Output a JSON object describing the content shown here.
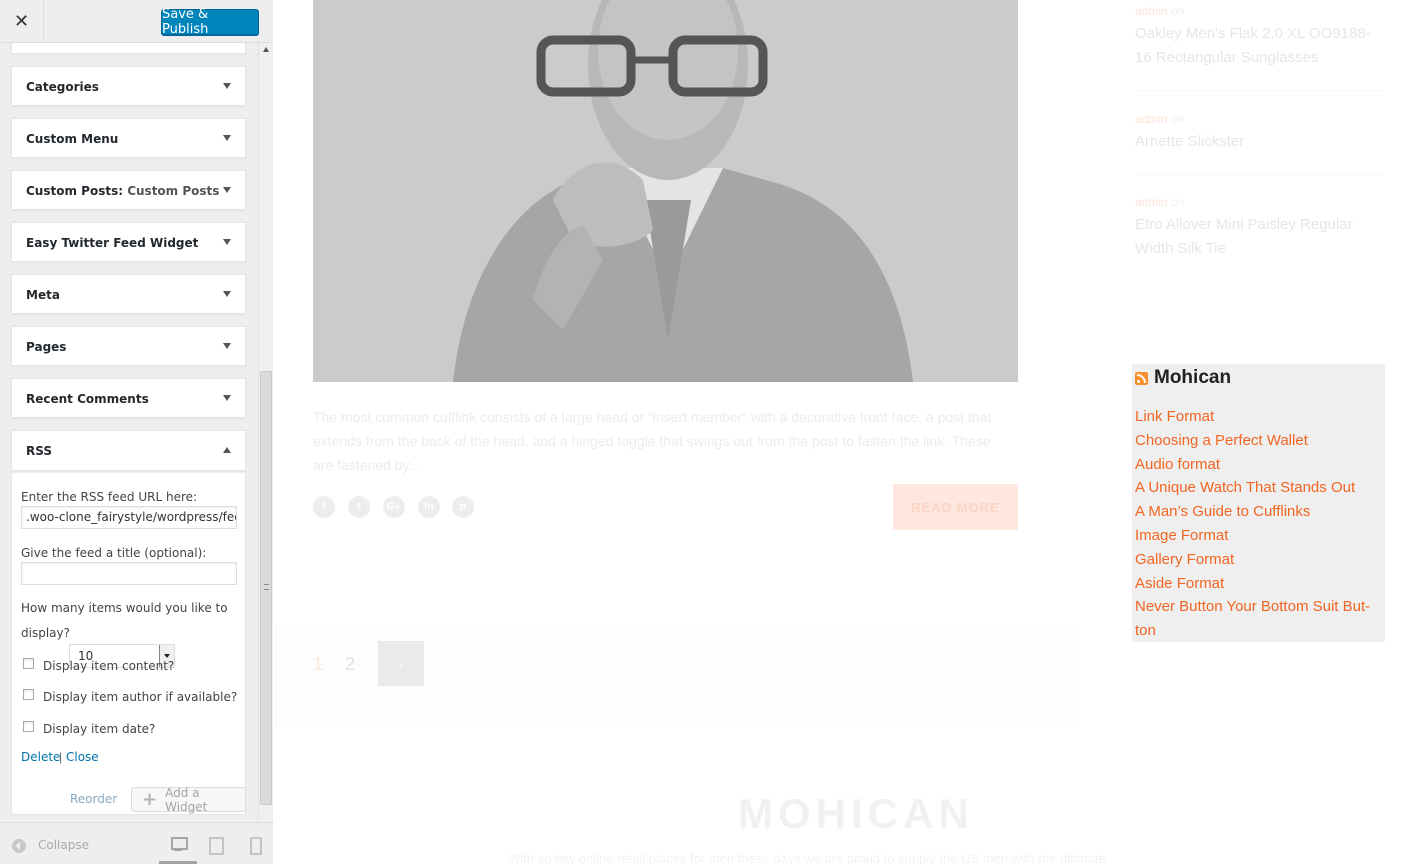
{
  "header": {
    "close_label": "✕",
    "save_label": "Save & Publish"
  },
  "widgets": [
    {
      "title": "Categories"
    },
    {
      "title": "Custom Menu"
    },
    {
      "title": "Custom Posts:",
      "subtitle": "Custom Posts"
    },
    {
      "title": "Easy Twitter Feed Widget"
    },
    {
      "title": "Meta"
    },
    {
      "title": "Pages"
    },
    {
      "title": "Recent Comments"
    },
    {
      "title": "RSS"
    }
  ],
  "rss_form": {
    "url_label": "Enter the RSS feed URL here:",
    "url_value": ".woo-clone_fairystyle/wordpress/feed",
    "title_label": "Give the feed a title (optional):",
    "title_value": "",
    "items_label_1": "How many items would you like to",
    "items_label_2": "display?",
    "items_value": "10",
    "check_content": "Display item content?",
    "check_author": "Display item author if available?",
    "check_date": "Display item date?",
    "delete_label": "Delete",
    "separator": "|",
    "close_label": "Close"
  },
  "actions": {
    "reorder_label": "Reorder",
    "add_widget_label": "Add a Widget",
    "add_icon": "+"
  },
  "footer": {
    "collapse_label": "Collapse"
  },
  "preview": {
    "excerpt": "The most common cufflink consists of a large head or “insert member” with a decorative front face, a post that extends from the back of the head, and a hinged toggle that swings out from the post to fasten the link. These are fastened by...",
    "share_icons": [
      "f",
      "t",
      "G+",
      "in",
      "p"
    ],
    "read_more": "READ MORE",
    "pages": [
      "1",
      "2"
    ],
    "next_symbol": "›",
    "recent_comments": [
      {
        "author": "admin",
        "on": "on",
        "title": "Oakley Men's Flak 2.0 XL OO9188-16 Rectangular Sunglasses"
      },
      {
        "author": "admin",
        "on": "on",
        "title": "Arnette Slickster"
      },
      {
        "author": "admin",
        "on": "on",
        "title": "Etro Allover Mini Paisley Regular Width Silk Tie"
      }
    ],
    "rss_widget": {
      "title": "Mohican",
      "items": [
        "Link Format",
        "Choosing a Perfect Wallet",
        "Audio format",
        "A Unique Watch That Stands Out",
        "A Man’s Guide to Cufflinks",
        "Image Format",
        "Gallery Format",
        "Aside Format",
        "Never Button Your Bottom Suit But-",
        "ton"
      ]
    },
    "footer_logo": "MOHICAN",
    "footer_text": "With so few online retail places for men these days we are proud to supply the US men with the ultimate"
  },
  "colors": {
    "accent": "#0085ba",
    "link": "#f26522",
    "rss_bg": "#efefef"
  }
}
